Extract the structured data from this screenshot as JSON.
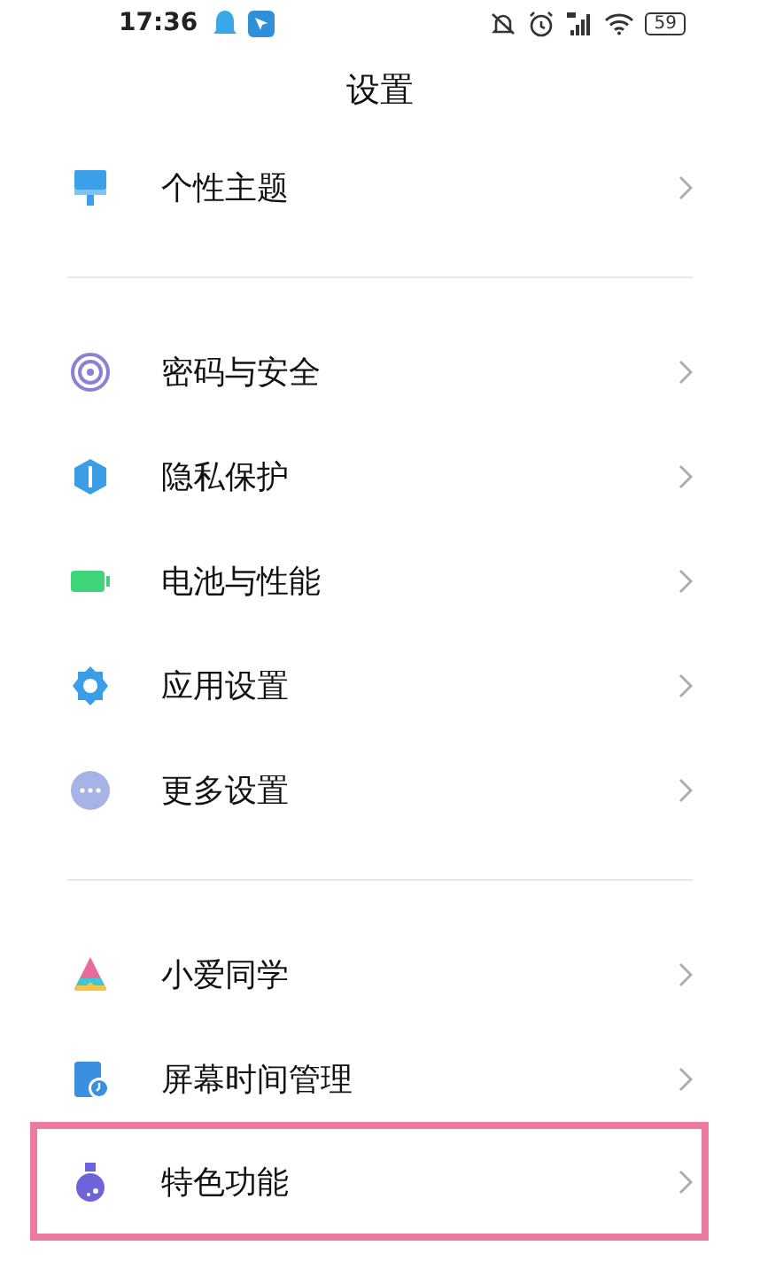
{
  "status_bar": {
    "time": "17:36",
    "battery": "59"
  },
  "title": "设置",
  "groups": [
    {
      "items": [
        {
          "label": "个性主题",
          "kind": "brush",
          "highlighted": false
        }
      ]
    },
    {
      "items": [
        {
          "label": "密码与安全",
          "kind": "fingerprint",
          "highlighted": false
        },
        {
          "label": "隐私保护",
          "kind": "shield",
          "highlighted": false
        },
        {
          "label": "电池与性能",
          "kind": "battery",
          "highlighted": false
        },
        {
          "label": "应用设置",
          "kind": "gear",
          "highlighted": false
        },
        {
          "label": "更多设置",
          "kind": "dots",
          "highlighted": false
        }
      ]
    },
    {
      "items": [
        {
          "label": "小爱同学",
          "kind": "assistant",
          "highlighted": false
        },
        {
          "label": "屏幕时间管理",
          "kind": "screentime",
          "highlighted": false
        },
        {
          "label": "特色功能",
          "kind": "flask",
          "highlighted": true
        }
      ]
    }
  ]
}
